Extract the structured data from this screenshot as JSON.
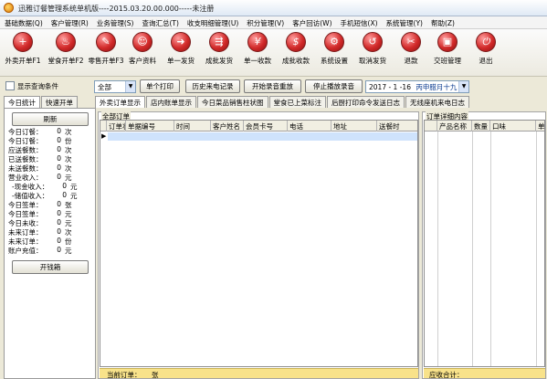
{
  "window": {
    "title": "迅雅订餐管理系统单机版----2015.03.20.00.000-----未注册"
  },
  "menu": [
    "基础数据(Q)",
    "客户管理(R)",
    "业务管理(S)",
    "查询汇总(T)",
    "收支明细管理(U)",
    "积分管理(V)",
    "客户回访(W)",
    "手机短信(X)",
    "系统管理(Y)",
    "帮助(Z)"
  ],
  "toolbar": [
    {
      "label": "外卖开单F1",
      "icon": "add-order-icon",
      "glyph": "+"
    },
    {
      "label": "堂食开单F2",
      "icon": "dine-in-icon",
      "glyph": "♨"
    },
    {
      "label": "零售开单F3",
      "icon": "retail-icon",
      "glyph": "✎"
    },
    {
      "label": "客户资料",
      "icon": "customer-icon",
      "glyph": "☺"
    },
    {
      "label": "单一发货",
      "icon": "ship-icon",
      "glyph": "➜"
    },
    {
      "label": "成批发货",
      "icon": "batch-ship-icon",
      "glyph": "⇶"
    },
    {
      "label": "单一收款",
      "icon": "receive-icon",
      "glyph": "¥"
    },
    {
      "label": "成批收款",
      "icon": "batch-receive-icon",
      "glyph": "$"
    },
    {
      "label": "系统设置",
      "icon": "settings-icon",
      "glyph": "⚙"
    },
    {
      "label": "取消发货",
      "icon": "cancel-ship-icon",
      "glyph": "↺"
    },
    {
      "label": "退款",
      "icon": "refund-icon",
      "glyph": "✂"
    },
    {
      "label": "交班管理",
      "icon": "shift-icon",
      "glyph": "▣"
    },
    {
      "label": "退出",
      "icon": "exit-icon",
      "glyph": "⏻"
    }
  ],
  "filter": {
    "show_query_label": "显示查询条件",
    "dropdown_value": "全部",
    "print_button": "单个打印",
    "history_button": "历史来电记录",
    "start_record_button": "开始录音重放",
    "stop_record_button": "停止播放录音",
    "date_value": "2017 - 1  -16",
    "lunar_date": "丙申腊月十九"
  },
  "left_tabs": [
    "今日统计",
    "快速开单"
  ],
  "main_tabs": [
    "外卖订单显示",
    "店内账单显示",
    "今日菜品销售柱状图",
    "堂食已上菜标注",
    "后厨打印命令发送日志",
    "无线座机来电日志"
  ],
  "stats": {
    "refresh_button": "刷新",
    "rows": [
      {
        "k": "今日订餐：",
        "v": "0",
        "u": "次"
      },
      {
        "k": "今日订餐：",
        "v": "0",
        "u": "份"
      },
      {
        "k": "应送餐数：",
        "v": "0",
        "u": "次"
      },
      {
        "k": "已送餐数：",
        "v": "0",
        "u": "次"
      },
      {
        "k": "未送餐数：",
        "v": "0",
        "u": "次"
      },
      {
        "k": "营业收入：",
        "v": "0",
        "u": "元"
      },
      {
        "k": "-现金收入：",
        "v": "0",
        "u": "元"
      },
      {
        "k": "-储值收入：",
        "v": "0",
        "u": "元"
      },
      {
        "k": "今日签单：",
        "v": "0",
        "u": "张"
      },
      {
        "k": "今日签单：",
        "v": "0",
        "u": "元"
      },
      {
        "k": "今日未收：",
        "v": "0",
        "u": "元"
      },
      {
        "k": "未来订单：",
        "v": "0",
        "u": "次"
      },
      {
        "k": "未来订单：",
        "v": "0",
        "u": "份"
      },
      {
        "k": "账户充值：",
        "v": "0",
        "u": "元"
      }
    ],
    "cash_box_button": "开钱箱"
  },
  "orders": {
    "group_title": "全部订单",
    "columns": [
      "订单状态",
      "单据编号",
      "时间",
      "客户姓名",
      "会员卡号",
      "电话",
      "地址",
      "送餐时"
    ],
    "footer_label": "当前订单：",
    "footer_value": "张"
  },
  "details": {
    "group_title": "订单详细内容",
    "columns": [
      "产品名称",
      "数量",
      "口味",
      "单"
    ],
    "footer_label": "应收合计："
  },
  "colors": {
    "accent": "#cfe3fc",
    "footer": "#f8e28a",
    "icon_red": "#d22a2a"
  }
}
